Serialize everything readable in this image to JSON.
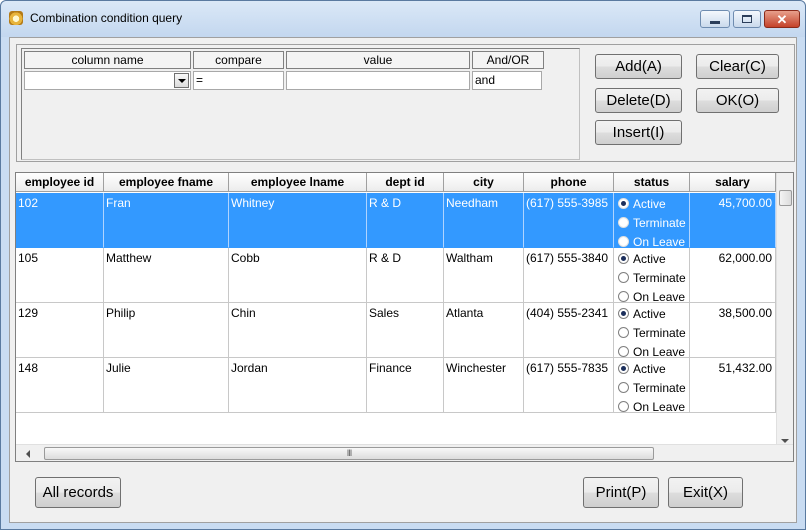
{
  "window": {
    "title": "Combination condition query",
    "colors": {
      "title_bg": "#c9dcf2",
      "selection": "#3399ff",
      "close_button": "#c4422a"
    }
  },
  "condition": {
    "headers": [
      "column name",
      "compare",
      "value",
      "And/OR"
    ],
    "row": {
      "column_name": "",
      "compare": "=",
      "value": "",
      "and_or": "and"
    }
  },
  "buttons": {
    "add": "Add(A)",
    "clear": "Clear(C)",
    "delete": "Delete(D)",
    "ok": "OK(O)",
    "insert": "Insert(I)",
    "all_records": "All records",
    "print": "Print(P)",
    "exit": "Exit(X)"
  },
  "grid": {
    "columns": [
      "employee id",
      "employee fname",
      "employee lname",
      "dept id",
      "city",
      "phone",
      "status",
      "salary"
    ],
    "status_options": [
      "Active",
      "Terminate",
      "On Leave"
    ],
    "rows": [
      {
        "id": "102",
        "fname": "Fran",
        "lname": "Whitney",
        "dept": "R & D",
        "city": "Needham",
        "phone": "(617) 555-3985",
        "status": "Active",
        "salary": "45,700.00"
      },
      {
        "id": "105",
        "fname": "Matthew",
        "lname": "Cobb",
        "dept": "R & D",
        "city": "Waltham",
        "phone": "(617) 555-3840",
        "status": "Active",
        "salary": "62,000.00"
      },
      {
        "id": "129",
        "fname": "Philip",
        "lname": "Chin",
        "dept": "Sales",
        "city": "Atlanta",
        "phone": "(404) 555-2341",
        "status": "Active",
        "salary": "38,500.00"
      },
      {
        "id": "148",
        "fname": "Julie",
        "lname": "Jordan",
        "dept": "Finance",
        "city": "Winchester",
        "phone": "(617) 555-7835",
        "status": "Active",
        "salary": "51,432.00"
      }
    ],
    "selected_row": 0,
    "hscroll_glyph": "III"
  }
}
